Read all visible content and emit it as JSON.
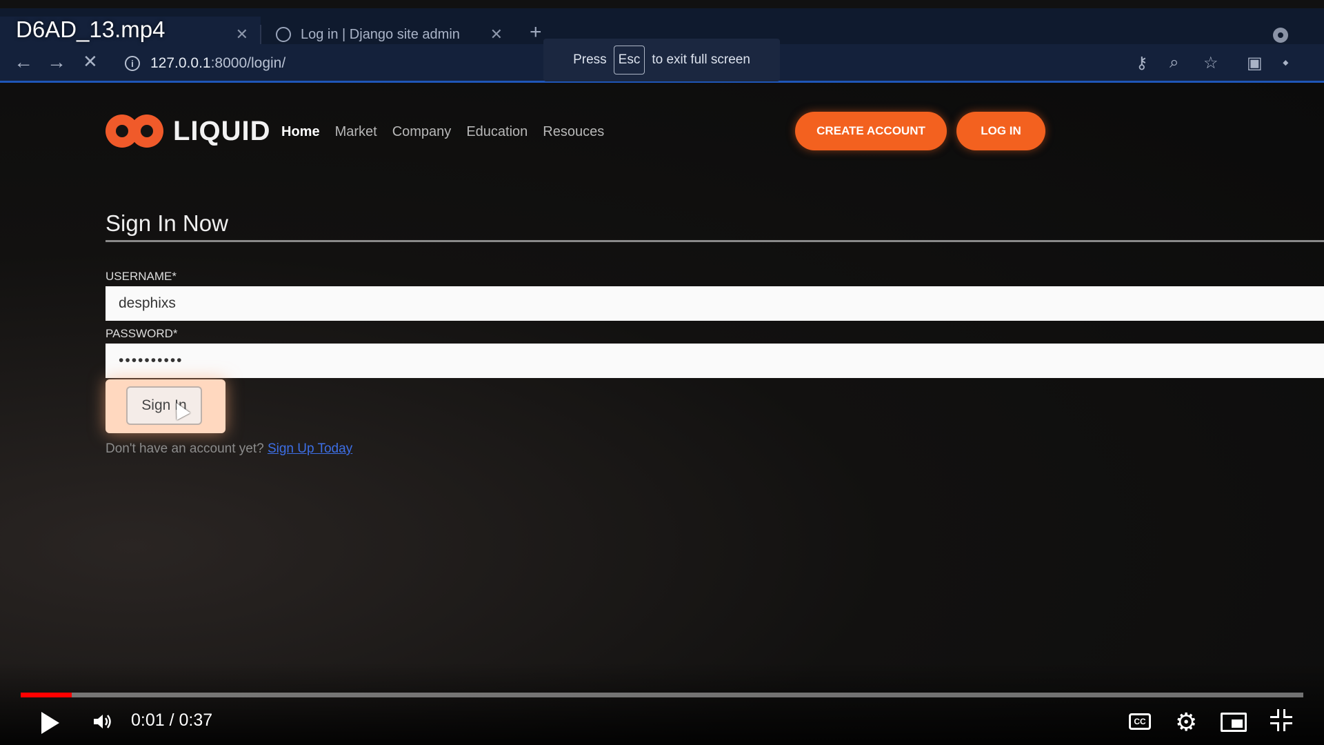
{
  "player": {
    "video_title": "D6AD_13.mp4",
    "time_current": "0:01",
    "time_separator": " / ",
    "time_total": "0:37",
    "progress_fraction": 0.04,
    "accent_color": "#ff0000"
  },
  "browser": {
    "tabs": [
      {
        "label": "",
        "active": true
      },
      {
        "label": "Log in | Django site admin",
        "active": false
      }
    ],
    "url_host": "127.0.0.1",
    "url_rest": ":8000/login/",
    "fullscreen_toast": {
      "prefix": "Press",
      "key": "Esc",
      "suffix": "to exit full screen"
    }
  },
  "site": {
    "brand": "LIQUID",
    "brand_color": "#f05a2a",
    "menu": [
      "Home",
      "Market",
      "Company",
      "Education",
      "Resouces"
    ],
    "create_account_label": "CREATE ACCOUNT",
    "login_label": "LOG IN",
    "button_color": "#f3611f"
  },
  "form": {
    "title": "Sign In Now",
    "username_label": "USERNAME*",
    "username_value": "desphixs",
    "password_label": "PASSWORD*",
    "password_value": "••••••••••",
    "signin_label": "Sign In",
    "no_account_text": "Don't have an account yet?",
    "signup_link": "Sign Up Today"
  }
}
